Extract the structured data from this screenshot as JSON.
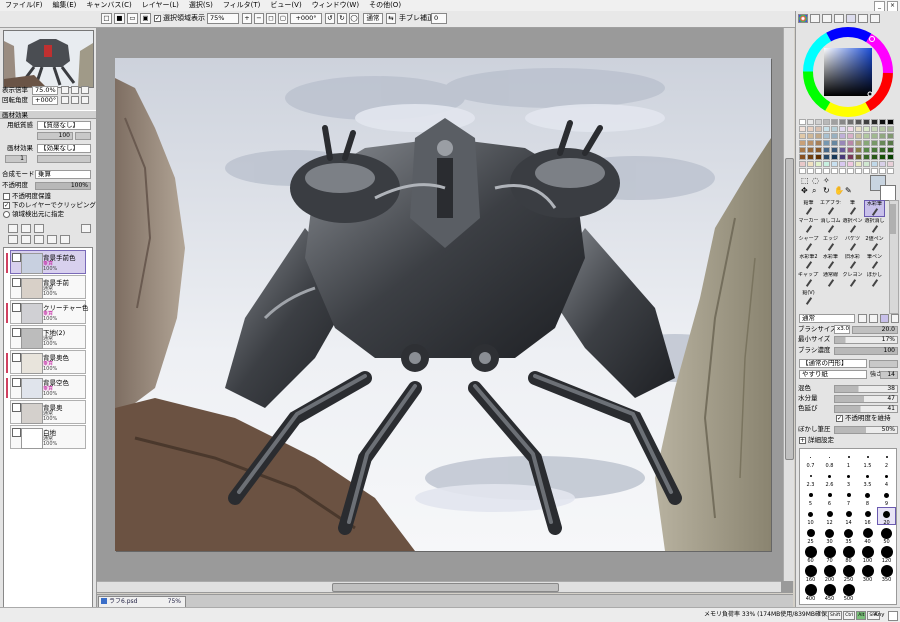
{
  "menubar": {
    "items": [
      "ファイル(F)",
      "編集(E)",
      "キャンバス(C)",
      "レイヤー(L)",
      "選択(S)",
      "フィルタ(T)",
      "ビュー(V)",
      "ウィンドウ(W)",
      "その他(O)"
    ]
  },
  "toolbar": {
    "antialias_label": "選択領域表示",
    "zoom_value": "75%",
    "rotation_value": "+000°",
    "blend_value": "通常",
    "stabilizer_label": "手ブレ補正",
    "stabilizer_value": "0"
  },
  "navigator": {
    "zoom_label": "表示倍率",
    "zoom_value": "75.0%",
    "angle_label": "回転角度",
    "angle_value": "+000°"
  },
  "layer_props": {
    "header": "画材効果",
    "paper_label": "用紙質感",
    "paper_value": "【質感なし】",
    "paper_scale": "100",
    "effect_label": "画材効果",
    "effect_value": "【効果なし】",
    "effect_scale": "1",
    "blend_label": "合成モード",
    "blend_value": "乗算",
    "opacity_label": "不透明度",
    "opacity_value": "100%",
    "protect_label": "不透明度保護",
    "clip_label": "下のレイヤーでクリッピング",
    "ref_label": "領域検出元に指定"
  },
  "layers": [
    {
      "name": "背景手前色",
      "mode": "乗算",
      "opacity": "100%",
      "selected": true,
      "clipped": true
    },
    {
      "name": "背景手前",
      "mode": "通常",
      "opacity": "100%",
      "selected": false,
      "clipped": false
    },
    {
      "name": "クリーチャー色",
      "mode": "乗算",
      "opacity": "100%",
      "selected": false,
      "clipped": true
    },
    {
      "name": "下地(2)",
      "mode": "通常",
      "opacity": "100%",
      "selected": false,
      "clipped": false
    },
    {
      "name": "背景奥色",
      "mode": "乗算",
      "opacity": "100%",
      "selected": false,
      "clipped": true
    },
    {
      "name": "背景空色",
      "mode": "乗算",
      "opacity": "100%",
      "selected": false,
      "clipped": true
    },
    {
      "name": "背景奥",
      "mode": "通常",
      "opacity": "100%",
      "selected": false,
      "clipped": false
    },
    {
      "name": "白地",
      "mode": "通常",
      "opacity": "100%",
      "selected": false,
      "clipped": false
    }
  ],
  "document_tab": {
    "filename": "ラフ6.psd",
    "zoom": "75%"
  },
  "status": {
    "memory": "メモリ負荷率 33% (174MB使用/839MB確保)",
    "keys": [
      "Shift",
      "Ctrl",
      "Alt",
      "SPC"
    ],
    "any": "Any"
  },
  "tools": [
    "鉛筆",
    "エアブラシ",
    "筆",
    "水彩筆",
    "マーカー",
    "消しゴム",
    "選択ペン",
    "選択消し",
    "シャープ",
    "エッジ",
    "バケツ",
    "2値ペン",
    "水彩筆2",
    "水彩筆",
    "旧水彩",
    "筆ペン",
    "ギャップアクリル",
    "通常線",
    "クレヨン",
    "ぼかし",
    "鉛(V)"
  ],
  "brush": {
    "mode": "通常",
    "size_label": "ブラシサイズ",
    "size_mult": "x3.0",
    "size_value": "20.0",
    "min_size_label": "最小サイズ",
    "min_size_value": "17%",
    "density_label": "ブラシ濃度",
    "density_value": "100",
    "shape_value": "【通常の円形】",
    "texture_value": "やすり紙",
    "texture_strength_label": "強さ",
    "texture_strength": "14",
    "blend_label": "混色",
    "blend_value": "38",
    "water_label": "水分量",
    "water_value": "47",
    "persist_label": "色延び",
    "persist_value": "41",
    "keep_opacity_label": "不透明度を維持",
    "blur_label": "ぼかし筆圧",
    "blur_value": "50%",
    "detail_label": "詳細設定"
  },
  "brush_sizes": [
    "0.7",
    "0.8",
    "1",
    "1.5",
    "2",
    "2.3",
    "2.6",
    "3",
    "3.5",
    "4",
    "5",
    "6",
    "7",
    "8",
    "9",
    "10",
    "12",
    "14",
    "16",
    "20",
    "25",
    "30",
    "35",
    "40",
    "50",
    "60",
    "70",
    "80",
    "100",
    "120",
    "160",
    "200",
    "250",
    "300",
    "350",
    "400",
    "450",
    "500"
  ],
  "colors": {
    "accent": "#7a6ab8",
    "panel": "#e4e4e4",
    "workspace": "#9a9a9a"
  }
}
